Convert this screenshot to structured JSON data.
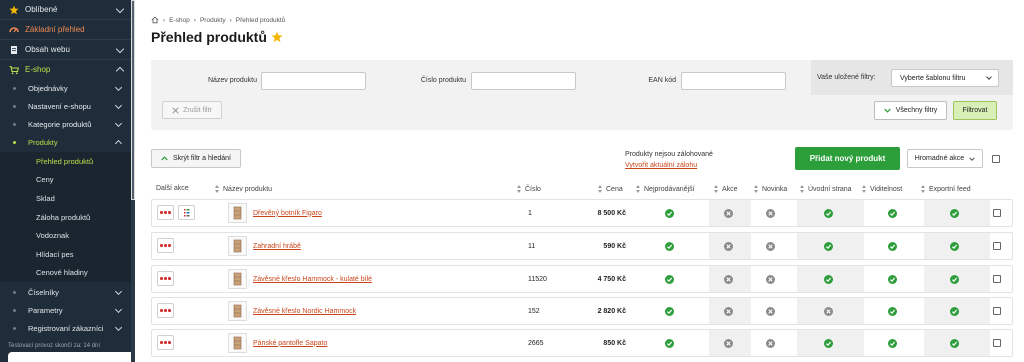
{
  "sidebar": {
    "favorites": "Oblíbené",
    "overview": "Základní přehled",
    "content": "Obsah webu",
    "eshop": "E-shop",
    "eshop_sub": [
      "Objednávky",
      "Nastavení e-shopu",
      "Kategorie produktů",
      "Produkty"
    ],
    "products_leaves": [
      "Přehled produktů",
      "Ceny",
      "Sklad",
      "Záloha produktů",
      "Vodoznak",
      "Hlídací pes",
      "Cenové hladiny"
    ],
    "bottom_sub": [
      "Číselníky",
      "Parametry",
      "Registrovaní zákazníci"
    ],
    "trial": "Testovací provoz skončí za: 14 dní"
  },
  "breadcrumb": [
    "E-shop",
    "Produkty",
    "Přehled produktů"
  ],
  "page_title": "Přehled produktů",
  "filters": {
    "name_label": "Název produktu",
    "number_label": "Číslo produktu",
    "ean_label": "EAN kód",
    "saved_label": "Vaše uložené filtry:",
    "saved_select": "Vyberte šablonu filtru",
    "clear": "Zrušit filtr",
    "all_filters": "Všechny filtry",
    "filter": "Filtrovat"
  },
  "toolbar": {
    "hide": "Skrýt filtr a hledání",
    "backup_text": "Produkty nejsou zálohované",
    "backup_link": "Vytvořit aktuální zálohu",
    "add": "Přidat nový produkt",
    "bulk": "Hromadné akce"
  },
  "table": {
    "headers": [
      "Další akce",
      "Název produktu",
      "Číslo",
      "Cena",
      "Nejprodávanější",
      "Akce",
      "Novinka",
      "Úvodní strana",
      "Viditelnost",
      "Exportní feed"
    ],
    "rows": [
      {
        "name": "Dřevěný botník Figaro",
        "number": "1",
        "price": "8 500 Kč",
        "flags": [
          true,
          false,
          false,
          true,
          true,
          true
        ]
      },
      {
        "name": "Zahradní hrábě",
        "number": "11",
        "price": "590 Kč",
        "flags": [
          true,
          false,
          false,
          true,
          true,
          true
        ]
      },
      {
        "name": "Závěsné křeslo Hammock - kulaté bílé",
        "number": "11520",
        "price": "4 750 Kč",
        "flags": [
          true,
          false,
          false,
          true,
          true,
          true
        ]
      },
      {
        "name": "Závěsné křeslo Nordic Hammock",
        "number": "152",
        "price": "2 820 Kč",
        "flags": [
          true,
          false,
          false,
          false,
          true,
          true
        ]
      },
      {
        "name": "Pánské pantofle Sapato",
        "number": "2665",
        "price": "850 Kč",
        "flags": [
          true,
          false,
          false,
          true,
          true,
          true
        ]
      }
    ]
  },
  "colors": {
    "sidebar": "#1f2d3a",
    "accent": "#b7e04a",
    "primary": "#2c9f3b",
    "link": "#c9461a"
  }
}
